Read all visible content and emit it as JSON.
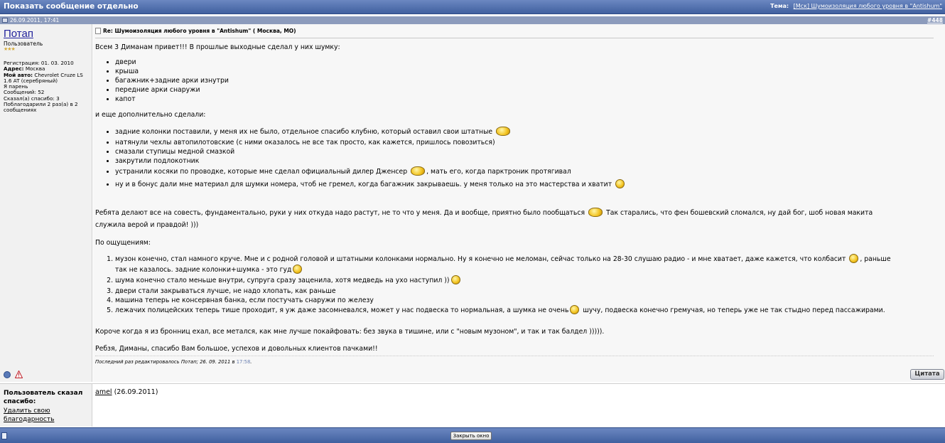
{
  "window": {
    "title": "Показать сообщение отдельно",
    "thread_label": "Тема:",
    "thread_title": "[Мск] Шумоизоляция любого уровня в \"Antishum\""
  },
  "post": {
    "date": "26.09.2011, 17:41",
    "number": "#448",
    "title": "Re: Шумоизоляция любого уровня в \"Antishum\" ( Москва, МО)",
    "body": {
      "intro": "Всем 3 Диманам привет!!! В прошлые выходные сделал у них шумку:",
      "list1": [
        "двери",
        "крыша",
        "багажник+задние арки изнутри",
        "передние арки снаружи",
        "капот"
      ],
      "extra_intro": "и еще дополнительно сделали:",
      "list2": [
        "задние колонки поставили, у меня их не было, отдельное спасибо клубню, который оставил свои штатные",
        "натянули чехлы автопилотовские (с ними оказалось не все так просто, как кажется, пришлось повозиться)",
        "смазали ступицы медной смазкой",
        "закрутили подлокотник",
        "устранили косяки по проводке, которые мне сделал официальный дилер Джен­сер",
        ", мать его, когда парктроник протягивал",
        "ну и в бонус дали мне материал для шумки номера, чтоб не гремел, когда багажник закрываешь. у меня только на это мастерства и хватит"
      ],
      "para1_a": "Ребята делают все на совесть, фундаментально, руки у них откуда надо растут, не то что у меня. Да и вообще, приятно было пообщаться",
      "para1_b": "Так старались, что фен бошевский сломался, ну дай бог, шоб новая макита",
      "para1_c": "служила верой и правдой! )))",
      "feel_intro": "По ощущениям:",
      "list3": [
        "музон конечно, стал намного круче. Мне и с родной головой и штатными колонками нормально. Ну я конечно не меломан, сейчас только на 28-30 слушаю радио - и мне хватает, даже кажется, что колбасит",
        ", раньше",
        "так не казалось. задние колонки+шумка - это гуд",
        "шума конечно стало меньше внутри, супруга сразу заценила, хотя медведь на ухо наступил ))",
        "двери стали закрываться лучше, не надо хлопать, как раньше",
        "машина теперь не консервная банка, если постучать снаружи по железу",
        "лежачих полицейских теперь тише проходит, я уж даже засомневался, может у нас подвеска то нормальная, а шумка не очень",
        "шучу, подвеска конечно гремучая, но теперь уже не так стыдно перед пассажирами."
      ],
      "para2": "Короче когда я из бронниц ехал, все метался, как мне лучше покайфовать: без звука в тишине, или с \"новым музоном\", и так и так балдел ))))).",
      "para3": "Ребзя, Диманы, спасибо Вам большое, успехов и довольных клиентов пачками!!"
    },
    "edit_note": "Последний раз редактировалось Потап; 26. 09. 2011 в",
    "edit_time": "17:58",
    "edit_dot": ".",
    "quote_label": "Цитата"
  },
  "author": {
    "name": "Потап",
    "rank": "Пользователь",
    "stars": "★★★",
    "reg_label": "Регистрация:",
    "reg_value": "01. 03. 2010",
    "addr_label": "Адрес:",
    "addr_value": "Москва",
    "car_label": "Мой авто:",
    "car_value": "Chevrolet Cruze LS 1.6 AT (серебряный)",
    "gender": "Я парень",
    "posts_label": "Сообщений:",
    "posts_value": "52",
    "thanked_label": "Сказал(а) спасибо:",
    "thanked_value": "3",
    "thanks_recv": "Поблагодарили 2 раз(а) в 2 сообщениях"
  },
  "thanks": {
    "header": "Пользователь сказал спасибо:",
    "remove_link": "Удалить свою благодарность",
    "user": "amel",
    "date": "(26.09.2011)"
  },
  "footer": {
    "close_label": "Закрыть окно"
  }
}
